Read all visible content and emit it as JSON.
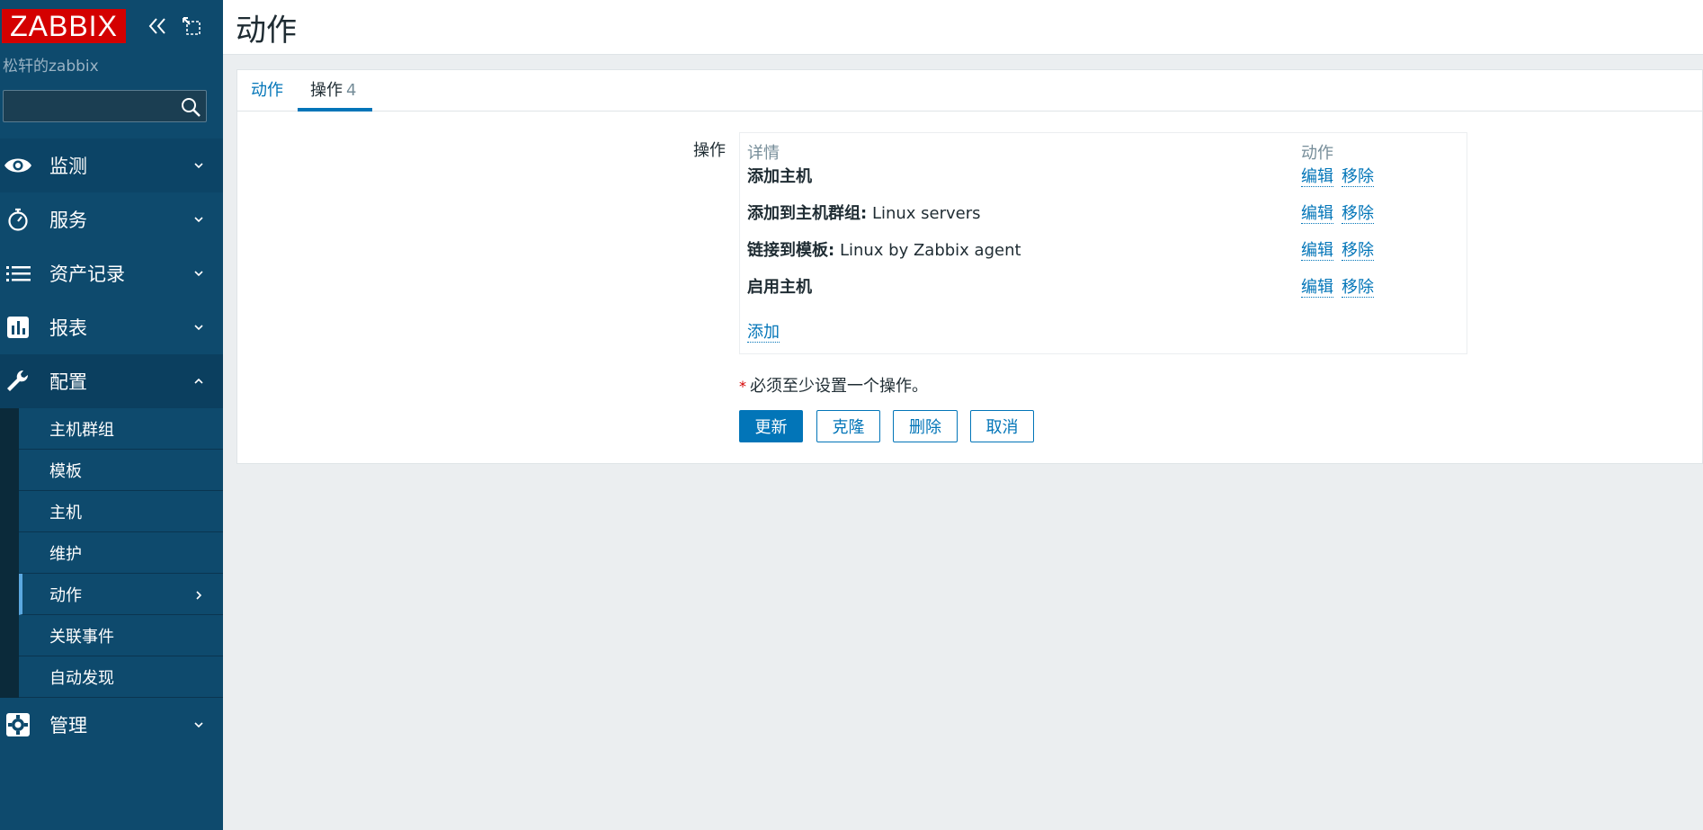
{
  "sidebar": {
    "logo_text": "ZABBIX",
    "server_name": "松轩的zabbix",
    "search": {
      "value": "",
      "placeholder": ""
    },
    "menu": [
      {
        "label": "监测",
        "icon": "eye-icon",
        "expanded": false
      },
      {
        "label": "服务",
        "icon": "stopwatch-icon",
        "expanded": false
      },
      {
        "label": "资产记录",
        "icon": "list-icon",
        "expanded": false
      },
      {
        "label": "报表",
        "icon": "bar-chart-icon",
        "expanded": false
      },
      {
        "label": "配置",
        "icon": "wrench-icon",
        "expanded": true
      },
      {
        "label": "管理",
        "icon": "gear-icon",
        "expanded": false
      }
    ],
    "config_submenu": [
      {
        "label": "主机群组"
      },
      {
        "label": "模板"
      },
      {
        "label": "主机"
      },
      {
        "label": "维护"
      },
      {
        "label": "动作",
        "selected": true
      },
      {
        "label": "关联事件"
      },
      {
        "label": "自动发现"
      }
    ]
  },
  "header": {
    "title": "动作"
  },
  "tabs": [
    {
      "label": "动作"
    },
    {
      "label": "操作",
      "count": "4"
    }
  ],
  "operations": {
    "field_label": "操作",
    "columns": {
      "details": "详情",
      "actions": "动作"
    },
    "rows": [
      {
        "prefix": "添加主机",
        "value": ""
      },
      {
        "prefix": "添加到主机群组:",
        "value": "Linux servers"
      },
      {
        "prefix": "链接到模板:",
        "value": "Linux by Zabbix agent"
      },
      {
        "prefix": "启用主机",
        "value": ""
      }
    ],
    "edit_label": "编辑",
    "remove_label": "移除",
    "add_label": "添加"
  },
  "required_note": "必须至少设置一个操作。",
  "buttons": {
    "update": "更新",
    "clone": "克隆",
    "delete": "删除",
    "cancel": "取消"
  },
  "colors": {
    "sidebar_bg": "#0e4a6d",
    "accent": "#0275b8",
    "logo_red": "#d40000"
  }
}
